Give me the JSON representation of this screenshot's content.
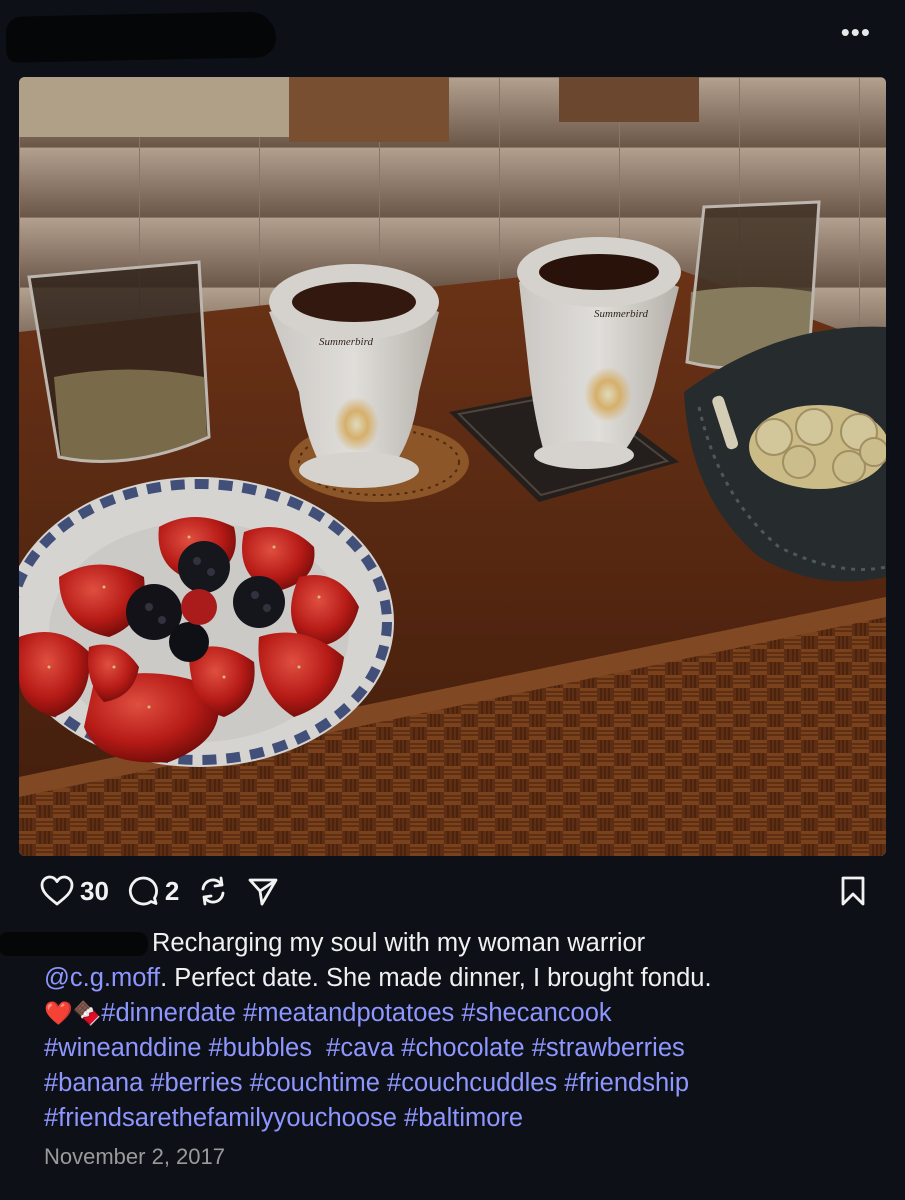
{
  "header": {
    "more_label": "•••"
  },
  "post": {
    "photo_label": "Dinner tray with chocolate fondue warmers, strawberries, blackberries, bananas and glasses of cava",
    "warmer_brand": "Summerbird",
    "likes": "30",
    "comments": "2",
    "caption": {
      "text_line1": "Recharging my soul with my woman warrior",
      "mention": "@c.g.moff",
      "text_line2": ". Perfect date. She made dinner, I brought fondu.",
      "emojis": "❤️🍫",
      "tags_line1": "#dinnerdate #meatandpotatoes #shecancook",
      "tags_line2": "#wineanddine #bubbles  #cava #chocolate #strawberries",
      "tags_line3": "#banana #berries #couchtime #couchcuddles #friendship",
      "tags_line4": "#friendsarethefamilyyouchoose #baltimore"
    },
    "date": "November 2, 2017"
  },
  "colors": {
    "background": "#0d1117",
    "link": "#8e96ff",
    "muted": "#9a9a9a"
  }
}
